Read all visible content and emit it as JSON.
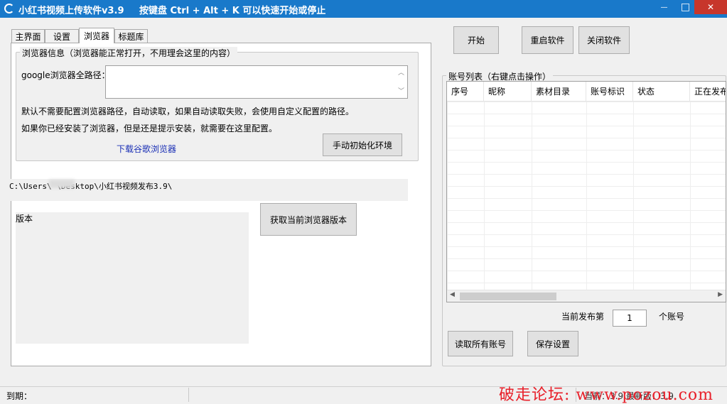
{
  "window": {
    "title": "小红书视频上传软件v3.9",
    "hint": "按键盘 Ctrl + Alt + K  可以快速开始或停止",
    "minimize_glyph": "—",
    "maximize_glyph": "□",
    "close_glyph": "✕"
  },
  "tabs": [
    {
      "label": "主界面"
    },
    {
      "label": "设置"
    },
    {
      "label": "浏览器"
    },
    {
      "label": "标题库"
    }
  ],
  "browser": {
    "group_title": "浏览器信息（浏览器能正常打开，不用理会这里的内容）",
    "path_label": "google浏览器全路径：",
    "path_value": "",
    "note1": "默认不需要配置浏览器路径，自动读取，如果自动读取失败，会使用自定义配置的路径。",
    "note2": "如果你已经安装了浏览器，但是还是提示安装，就需要在这里配置。",
    "download_link": "下载谷歌浏览器",
    "init_button": "手动初始化环境",
    "install_path": "C:\\Users\\      \\Desktop\\小红书视频发布3.9\\",
    "version_label": "版本",
    "get_version_button": "获取当前浏览器版本"
  },
  "controls": {
    "start": "开始",
    "restart": "重启软件",
    "close": "关闭软件"
  },
  "accounts": {
    "group_title": "账号列表（右键点击操作）",
    "columns": [
      "序号",
      "昵称",
      "素材目录",
      "账号标识",
      "状态",
      "正在发布"
    ],
    "rows": [],
    "current_label": "当前发布第",
    "current_value": "1",
    "current_suffix": "个账号",
    "read_all": "读取所有账号",
    "save": "保存设置"
  },
  "status": {
    "expiry": "到期：",
    "version": "当前：3.9  最新版：3.9"
  },
  "watermark": "破走论坛: www.pozou.com"
}
